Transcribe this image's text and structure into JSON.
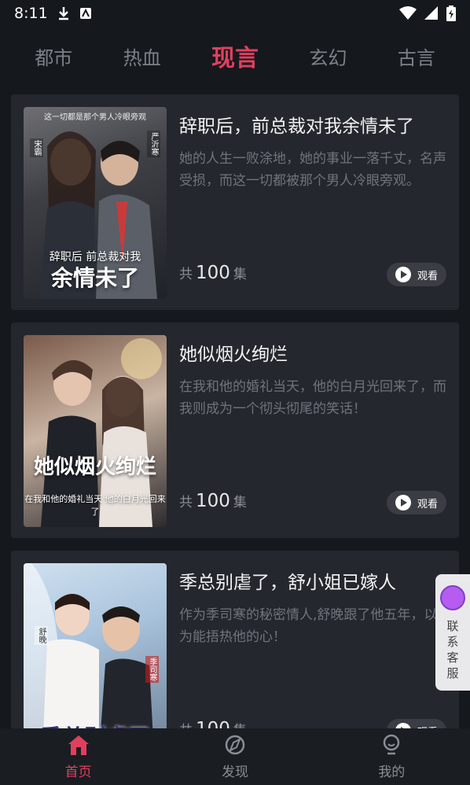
{
  "status_bar": {
    "time": "8:11"
  },
  "tabs": [
    {
      "label": "都市",
      "active": false
    },
    {
      "label": "热血",
      "active": false
    },
    {
      "label": "现言",
      "active": true
    },
    {
      "label": "玄幻",
      "active": false
    },
    {
      "label": "古言",
      "active": false
    }
  ],
  "cards": [
    {
      "title": "辞职后，前总裁对我余情未了",
      "description": "她的人生一败涂地，她的事业一落千丈，名声受损，而这一切都被那个男人冷眼旁观。",
      "count_prefix": "共",
      "count": "100",
      "count_suffix": "集",
      "watch_label": "观看",
      "poster": {
        "tagline": "这一切都是那个男人冷眼旁观",
        "subtitle": "辞职后 前总裁对我",
        "title": "余情未了",
        "name_left": "宋霸",
        "name_right": "严沂寒"
      }
    },
    {
      "title": "她似烟火绚烂",
      "description": "在我和他的婚礼当天，他的白月光回来了，而我则成为一个彻头彻尾的笑话！",
      "count_prefix": "共",
      "count": "100",
      "count_suffix": "集",
      "watch_label": "观看",
      "poster": {
        "title": "她似烟火绚烂",
        "subtitle": "在我和他的婚礼当天 他的白月光回来了"
      }
    },
    {
      "title": "季总别虐了，舒小姐已嫁人",
      "description": "作为季司寒的秘密情人,舒晚跟了他五年，以为能捂热他的心！",
      "count_prefix": "共",
      "count": "100",
      "count_suffix": "集",
      "watch_label": "观看",
      "poster": {
        "title": "季总别虐了",
        "name_left": "舒晚",
        "name_right": "季司寒"
      }
    }
  ],
  "customer_service": {
    "label": "联系客服"
  },
  "bottom_nav": [
    {
      "label": "首页",
      "icon": "home-icon",
      "active": true
    },
    {
      "label": "发现",
      "icon": "discover-icon",
      "active": false
    },
    {
      "label": "我的",
      "icon": "profile-icon",
      "active": false
    }
  ],
  "colors": {
    "accent": "#e23f5e",
    "background": "#15181d",
    "card": "#24272d"
  }
}
